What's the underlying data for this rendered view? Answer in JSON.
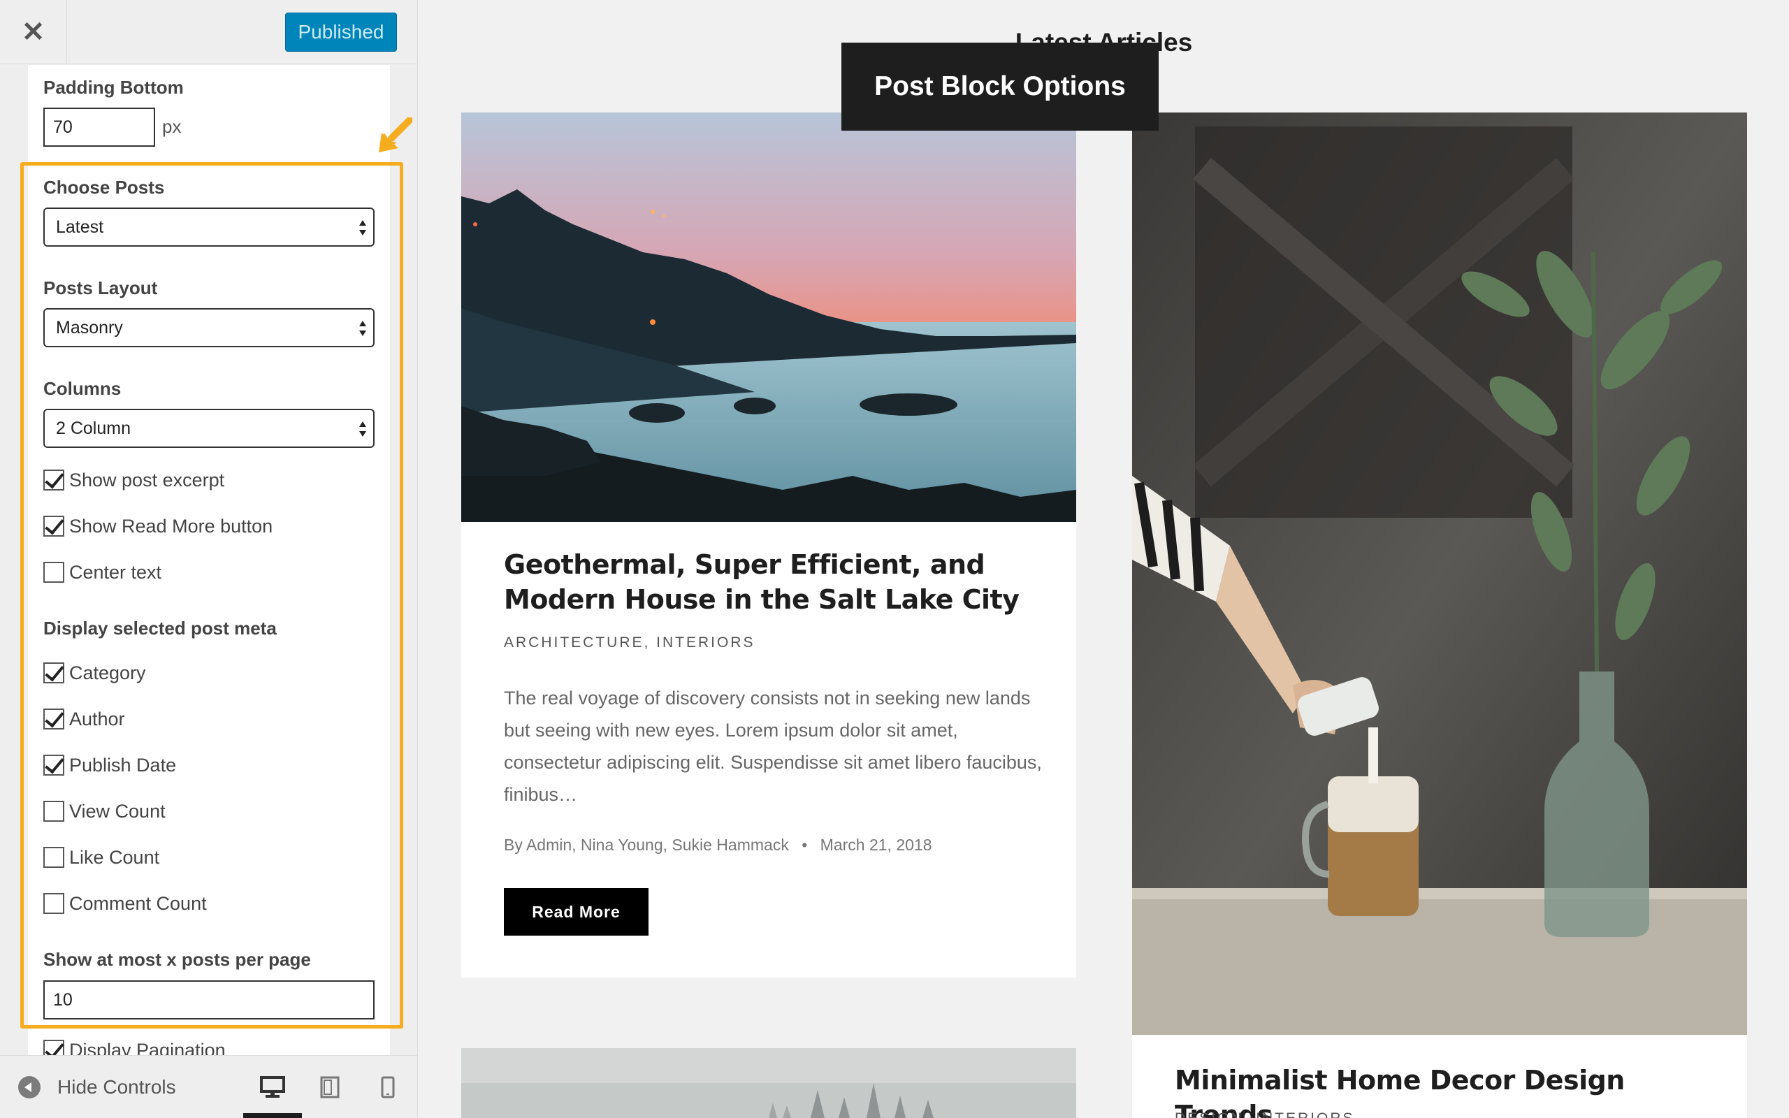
{
  "sidebar": {
    "close_icon": "close-icon",
    "publish_label": "Published",
    "padding_bottom": {
      "label": "Padding Bottom",
      "value": "70",
      "unit": "px"
    },
    "choose_posts": {
      "label": "Choose Posts",
      "value": "Latest"
    },
    "posts_layout": {
      "label": "Posts Layout",
      "value": "Masonry"
    },
    "columns": {
      "label": "Columns",
      "value": "2 Column"
    },
    "options": [
      {
        "label": "Show post excerpt",
        "checked": true
      },
      {
        "label": "Show Read More button",
        "checked": true
      },
      {
        "label": "Center text",
        "checked": false
      }
    ],
    "meta_heading": "Display selected post meta",
    "meta": [
      {
        "label": "Category",
        "checked": true
      },
      {
        "label": "Author",
        "checked": true
      },
      {
        "label": "Publish Date",
        "checked": true
      },
      {
        "label": "View Count",
        "checked": false
      },
      {
        "label": "Like Count",
        "checked": false
      },
      {
        "label": "Comment Count",
        "checked": false
      }
    ],
    "posts_per_page": {
      "label": "Show at most x posts per page",
      "value": "10"
    },
    "pagination": {
      "label": "Display Pagination",
      "checked": true
    },
    "footer": {
      "hide_controls_label": "Hide Controls",
      "devices": [
        "desktop-icon",
        "tablet-icon",
        "mobile-icon"
      ]
    },
    "accent_color": "#f5ad1f"
  },
  "preview": {
    "section_title": "Latest Articles",
    "block_label": "Post Block Options",
    "posts": [
      {
        "title": "Geothermal, Super Efficient, and Modern House in the Salt Lake City",
        "categories": "ARCHITECTURE, INTERIORS",
        "excerpt": "The real voyage of discovery consists not in seeking new lands but seeing with new eyes. Lorem ipsum dolor sit amet, consectetur adipiscing elit. Suspendisse sit amet libero faucibus, finibus…",
        "authors": "By Admin, Nina Young, Sukie Hammack",
        "date": "March 21, 2018",
        "read_more": "Read More"
      },
      {
        "title": "Minimalist Home Decor Design Trends",
        "categories": "DESIGN, INTERIORS"
      }
    ]
  }
}
